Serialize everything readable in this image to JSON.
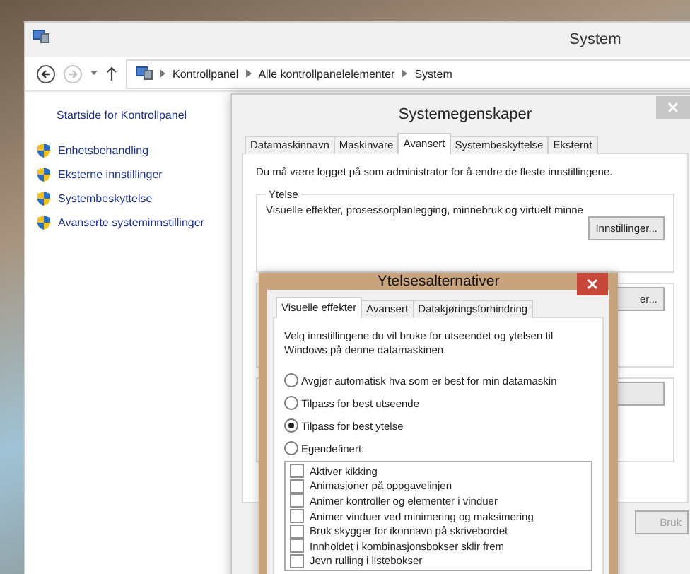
{
  "window": {
    "title": "System"
  },
  "address_bar": {
    "path": [
      "Kontrollpanel",
      "Alle kontrollpanelelementer",
      "System"
    ]
  },
  "sidebar": {
    "home_link": "Startside for Kontrollpanel",
    "items": [
      "Enhetsbehandling",
      "Eksterne innstillinger",
      "Systembeskyttelse",
      "Avanserte systeminnstillinger"
    ]
  },
  "system_properties": {
    "title": "Systemegenskaper",
    "tabs": [
      {
        "label": "Datamaskinnavn",
        "selected": false
      },
      {
        "label": "Maskinvare",
        "selected": false
      },
      {
        "label": "Avansert",
        "selected": true
      },
      {
        "label": "Systembeskyttelse",
        "selected": false
      },
      {
        "label": "Eksternt",
        "selected": false
      }
    ],
    "notice": "Du må være logget på som administrator for å endre de fleste innstillingene.",
    "performance_group": {
      "title": "Ytelse",
      "description": "Visuelle effekter, prosessorplanlegging, minnebruk og virtuelt minne",
      "button": "Innstillinger..."
    },
    "covered_button": "er...",
    "apply_button": {
      "label": "Bruk",
      "disabled": true
    }
  },
  "performance_options": {
    "title": "Ytelsesalternativer",
    "tabs": [
      {
        "label": "Visuelle effekter",
        "selected": true
      },
      {
        "label": "Avansert",
        "selected": false
      },
      {
        "label": "Datakjøringsforhindring",
        "selected": false
      }
    ],
    "intro": "Velg innstillingene du vil bruke for utseendet og ytelsen til Windows på denne datamaskinen.",
    "options": [
      {
        "label": "Avgjør automatisk hva som er best for min datamaskin",
        "selected": false
      },
      {
        "label": "Tilpass for best utseende",
        "selected": false
      },
      {
        "label": "Tilpass for best ytelse",
        "selected": true
      },
      {
        "label": "Egendefinert:",
        "selected": false
      }
    ],
    "effects": [
      {
        "label": "Aktiver kikking",
        "checked": false
      },
      {
        "label": "Animasjoner på oppgavelinjen",
        "checked": false
      },
      {
        "label": "Animer kontroller og elementer i vinduer",
        "checked": false
      },
      {
        "label": "Animer vinduer ved minimering og maksimering",
        "checked": false
      },
      {
        "label": "Bruk skygger for ikonnavn på skrivebordet",
        "checked": false
      },
      {
        "label": "Innholdet i kombinasjonsbokser sklir frem",
        "checked": false
      },
      {
        "label": "Jevn rulling i listebokser",
        "checked": false
      }
    ]
  }
}
